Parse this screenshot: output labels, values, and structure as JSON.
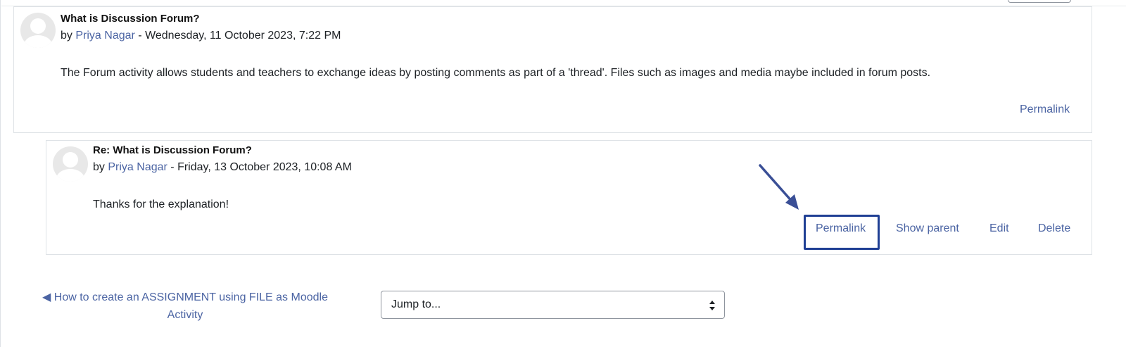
{
  "colors": {
    "link": "#4b64a3",
    "highlight_border": "#1f3f94",
    "text": "#1d2125",
    "border": "#dee2e6"
  },
  "posts": [
    {
      "subject": "What is Discussion Forum?",
      "by": "by",
      "author": "Priya Nagar",
      "date": " - Wednesday, 11 October 2023, 7:22 PM",
      "message": "The Forum activity allows students and teachers to exchange ideas by posting comments as part of a 'thread'. Files such as images and media maybe included in forum posts.",
      "commands": {
        "permalink": "Permalink"
      },
      "avatar_icon": "user-avatar-icon"
    },
    {
      "subject": "Re: What is Discussion Forum?",
      "by": "by",
      "author": "Priya Nagar",
      "date": " - Friday, 13 October 2023, 10:08 AM",
      "message": "Thanks for the explanation!",
      "commands": {
        "permalink": "Permalink",
        "show_parent": "Show parent",
        "edit": "Edit",
        "delete": "Delete"
      },
      "avatar_icon": "user-avatar-icon"
    }
  ],
  "annotation": {
    "highlighted_item": "Permalink",
    "arrow_icon": "arrow-pointer-icon"
  },
  "navigation": {
    "prev_activity": "◀ How to create an ASSIGNMENT using FILE as Moodle Activity",
    "jump_to": "Jump to..."
  }
}
